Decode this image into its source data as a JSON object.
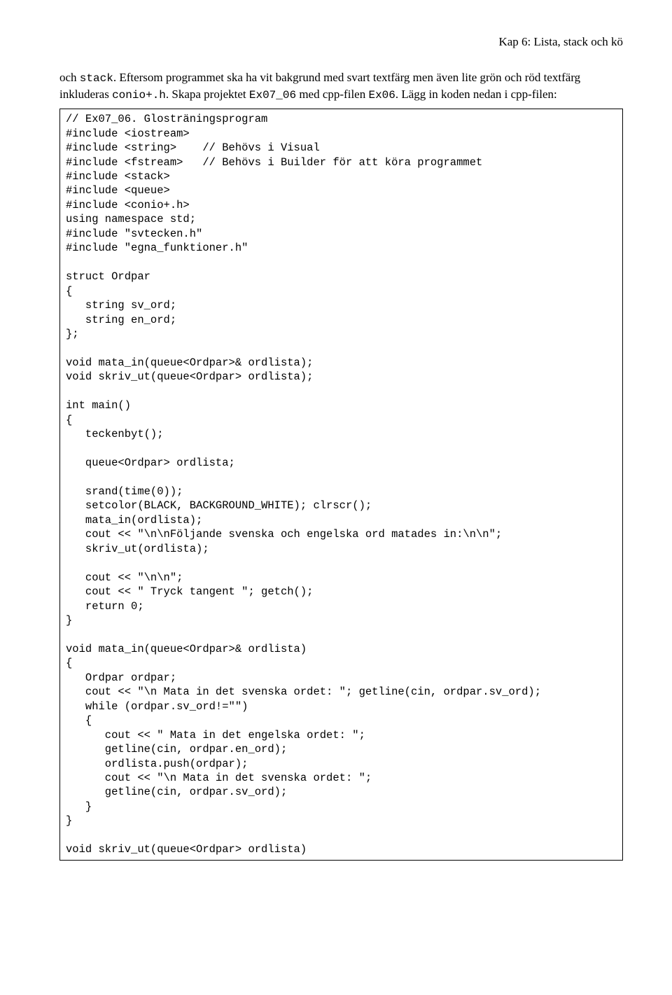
{
  "header": {
    "chapter": "Kap 6:  Lista, stack och kö"
  },
  "para": {
    "p1a": "och ",
    "p1b": "stack",
    "p1c": ". Eftersom programmet ska ha vit bakgrund med svart textfärg men även lite grön och röd textfärg inkluderas ",
    "p1d": "conio+.h",
    "p1e": ". Skapa projektet ",
    "p1f": "Ex07_06",
    "p1g": " med cpp-filen ",
    "p1h": "Ex06",
    "p1i": ". Lägg in koden nedan i cpp-filen:"
  },
  "code": {
    "text": "// Ex07_06. Glosträningsprogram\n#include <iostream>\n#include <string>    // Behövs i Visual\n#include <fstream>   // Behövs i Builder för att köra programmet\n#include <stack>\n#include <queue>\n#include <conio+.h>\nusing namespace std;\n#include \"svtecken.h\"\n#include \"egna_funktioner.h\"\n\nstruct Ordpar\n{\n   string sv_ord;\n   string en_ord;\n};\n\nvoid mata_in(queue<Ordpar>& ordlista);\nvoid skriv_ut(queue<Ordpar> ordlista);\n\nint main()\n{\n   teckenbyt();\n\n   queue<Ordpar> ordlista;\n\n   srand(time(0));\n   setcolor(BLACK, BACKGROUND_WHITE); clrscr();\n   mata_in(ordlista);\n   cout << \"\\n\\nFöljande svenska och engelska ord matades in:\\n\\n\";\n   skriv_ut(ordlista);\n\n   cout << \"\\n\\n\";\n   cout << \" Tryck tangent \"; getch();\n   return 0;\n}\n\nvoid mata_in(queue<Ordpar>& ordlista)\n{\n   Ordpar ordpar;\n   cout << \"\\n Mata in det svenska ordet: \"; getline(cin, ordpar.sv_ord);\n   while (ordpar.sv_ord!=\"\")\n   {\n      cout << \" Mata in det engelska ordet: \";\n      getline(cin, ordpar.en_ord);\n      ordlista.push(ordpar);\n      cout << \"\\n Mata in det svenska ordet: \";\n      getline(cin, ordpar.sv_ord);\n   }\n}\n\nvoid skriv_ut(queue<Ordpar> ordlista)"
  }
}
